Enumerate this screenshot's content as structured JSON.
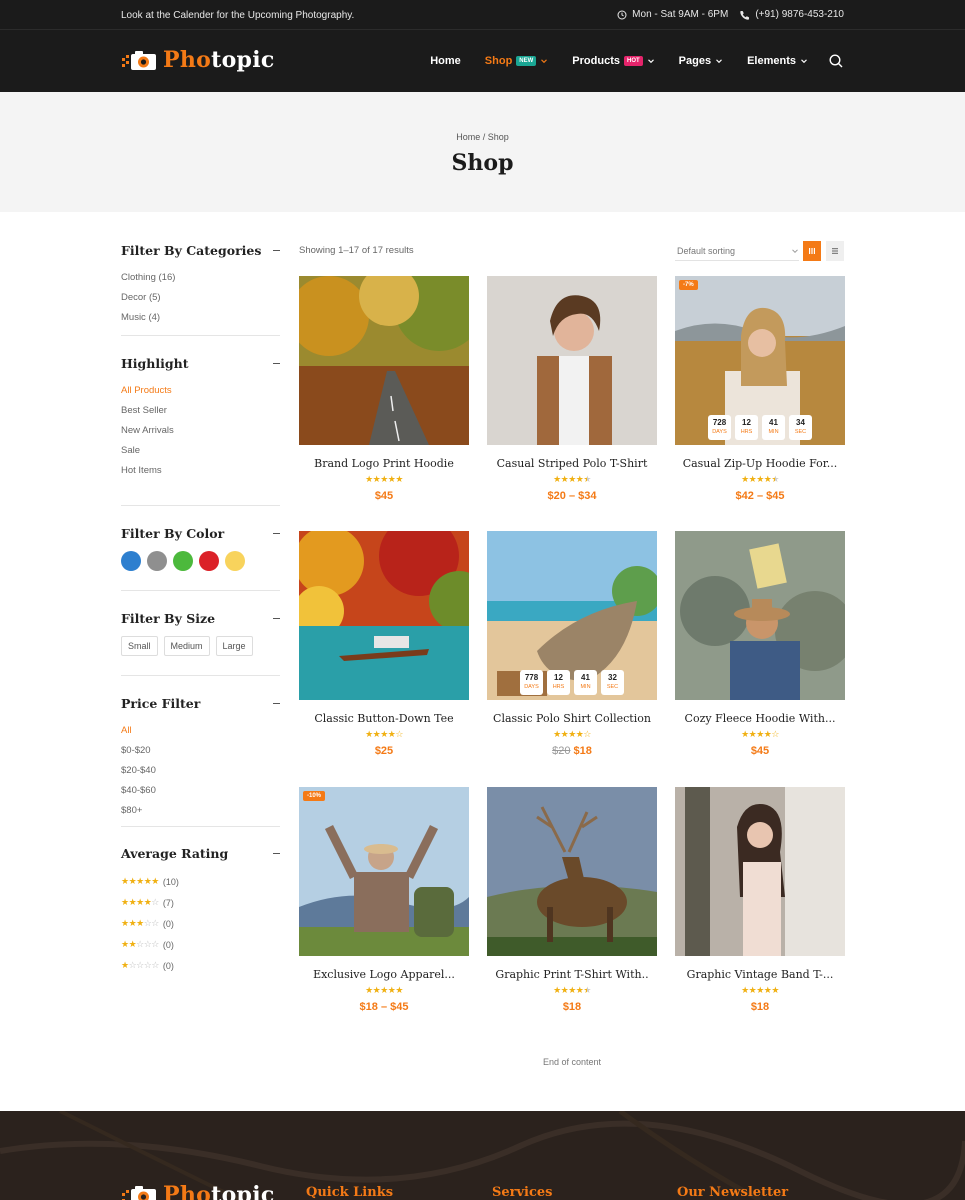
{
  "topbar": {
    "notice": "Look at the Calender for the Upcoming Photography.",
    "hours": "Mon - Sat 9AM - 6PM",
    "phone": "(+91) 9876-453-210"
  },
  "brand": {
    "part1": "Pho",
    "part2": "topic"
  },
  "nav": {
    "home": "Home",
    "shop": "Shop",
    "shop_badge": "NEW",
    "products": "Products",
    "products_badge": "HOT",
    "pages": "Pages",
    "elements": "Elements"
  },
  "page": {
    "breadcrumb": "Home / Shop",
    "title": "Shop"
  },
  "sidebar": {
    "categories": {
      "title": "Filter By Categories",
      "items": [
        "Clothing (16)",
        "Decor (5)",
        "Music (4)"
      ]
    },
    "highlight": {
      "title": "Highlight",
      "items": [
        "All Products",
        "Best Seller",
        "New Arrivals",
        "Sale",
        "Hot Items"
      ]
    },
    "color": {
      "title": "Filter By Color",
      "swatches": [
        "#2d7fcf",
        "#8f8f8f",
        "#4cb93c",
        "#db2128",
        "#f8d35c"
      ]
    },
    "size": {
      "title": "Filter By Size",
      "items": [
        "Small",
        "Medium",
        "Large"
      ]
    },
    "price": {
      "title": "Price Filter",
      "items": [
        "All",
        "$0-$20",
        "$20-$40",
        "$40-$60",
        "$80+"
      ]
    },
    "rating": {
      "title": "Average Rating",
      "counts": [
        "(10)",
        "(7)",
        "(0)",
        "(0)",
        "(0)"
      ],
      "stars": [
        5,
        4,
        3,
        2,
        1
      ]
    }
  },
  "toolbar": {
    "results": "Showing 1–17 of 17 results",
    "sorting": "Default sorting"
  },
  "countdown_labels": {
    "days": "DAYS",
    "hrs": "HRS",
    "min": "MIN",
    "sec": "SEC"
  },
  "products": [
    {
      "title": "Brand Logo Print Hoodie",
      "price": "$45",
      "rating": 5
    },
    {
      "title": "Casual Striped Polo T-Shirt",
      "price": "$20 – $34",
      "rating": 4.5
    },
    {
      "title": "Casual Zip-Up Hoodie For...",
      "price": "$42 – $45",
      "rating": 4.5,
      "badge": "-7%",
      "countdown": [
        "728",
        "12",
        "41",
        "34"
      ]
    },
    {
      "title": "Classic Button-Down Tee",
      "price": "$25",
      "rating": 4
    },
    {
      "title": "Classic Polo Shirt Collection",
      "old_price": "$20",
      "price": "$18",
      "rating": 4,
      "countdown": [
        "778",
        "12",
        "41",
        "32"
      ]
    },
    {
      "title": "Cozy Fleece Hoodie With...",
      "price": "$45",
      "rating": 4
    },
    {
      "title": "Exclusive Logo Apparel...",
      "price": "$18 – $45",
      "rating": 5,
      "badge": "-10%"
    },
    {
      "title": "Graphic Print T-Shirt With..",
      "price": "$18",
      "rating": 4.5
    },
    {
      "title": "Graphic Vintage Band T-...",
      "price": "$18",
      "rating": 5
    }
  ],
  "end_note": "End of content",
  "footer": {
    "quick_links": "Quick Links",
    "services": "Services",
    "newsletter": "Our Newsletter"
  }
}
